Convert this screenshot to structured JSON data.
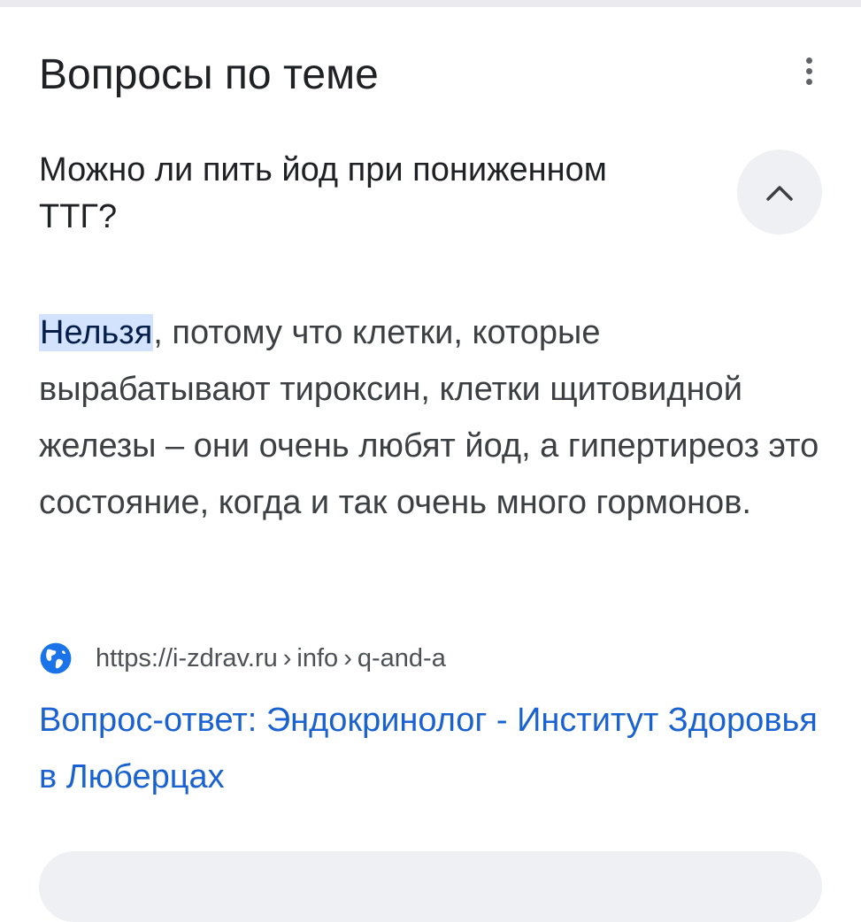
{
  "section": {
    "title": "Вопросы по теме",
    "more_icon": "more-vert-icon"
  },
  "qa": {
    "question": "Можно ли пить йод при пониженном ТТГ?",
    "toggle_icon": "chevron-up-icon",
    "answer_highlight": "Нельзя",
    "answer_rest": ", потому что клетки, которые вырабатывают тироксин, клетки щитовидной железы – они очень любят йод, а гипертиреоз это состояние, когда и так очень много гормонов."
  },
  "source": {
    "icon": "globe-icon",
    "url_base": "https://i-zdrav.ru",
    "url_path": [
      "info",
      "q-and-a"
    ],
    "separator": "›",
    "link_title": "Вопрос-ответ: Эндокринолог - Институт Здоровья в Люберцах"
  },
  "colors": {
    "link": "#1a62d2",
    "highlight_bg": "#d3e3fd",
    "globe": "#1a73e8"
  }
}
